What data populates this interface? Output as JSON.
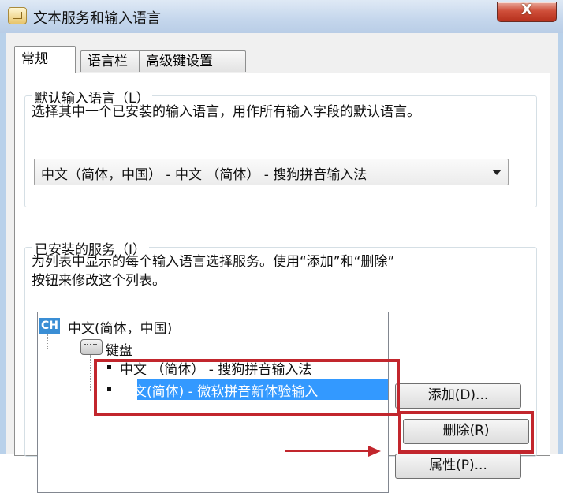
{
  "window": {
    "title": "文本服务和输入语言",
    "close_symbol": "X"
  },
  "tabs": [
    "常规",
    "语言栏",
    "高级键设置"
  ],
  "default_language": {
    "group_title": "默认输入语言（L）",
    "description": "选择其中一个已安装的输入语言，用作所有输入字段的默认语言。",
    "selected": "中文（简体，中国） - 中文 （简体） - 搜狗拼音输入法"
  },
  "installed_services": {
    "group_title": "已安装的服务（I）",
    "description_line1": "为列表中显示的每个输入语言选择服务。使用“添加”和“删除”",
    "description_line2": "按钮来修改这个列表。",
    "language_badge": "CH",
    "language_label": "中文(简体，中国)",
    "keyboard_label": "键盘",
    "items": [
      "中文 （简体） - 搜狗拼音输入法",
      "中文(简体) - 微软拼音新体验输入"
    ]
  },
  "buttons": {
    "add": "添加(D)...",
    "remove": "删除(R)",
    "properties": "属性(P)..."
  },
  "annotation_color": "#c2262d",
  "icons": [
    "keyboard-icon",
    "close-icon",
    "dropdown-arrow-icon",
    "app-icon"
  ]
}
